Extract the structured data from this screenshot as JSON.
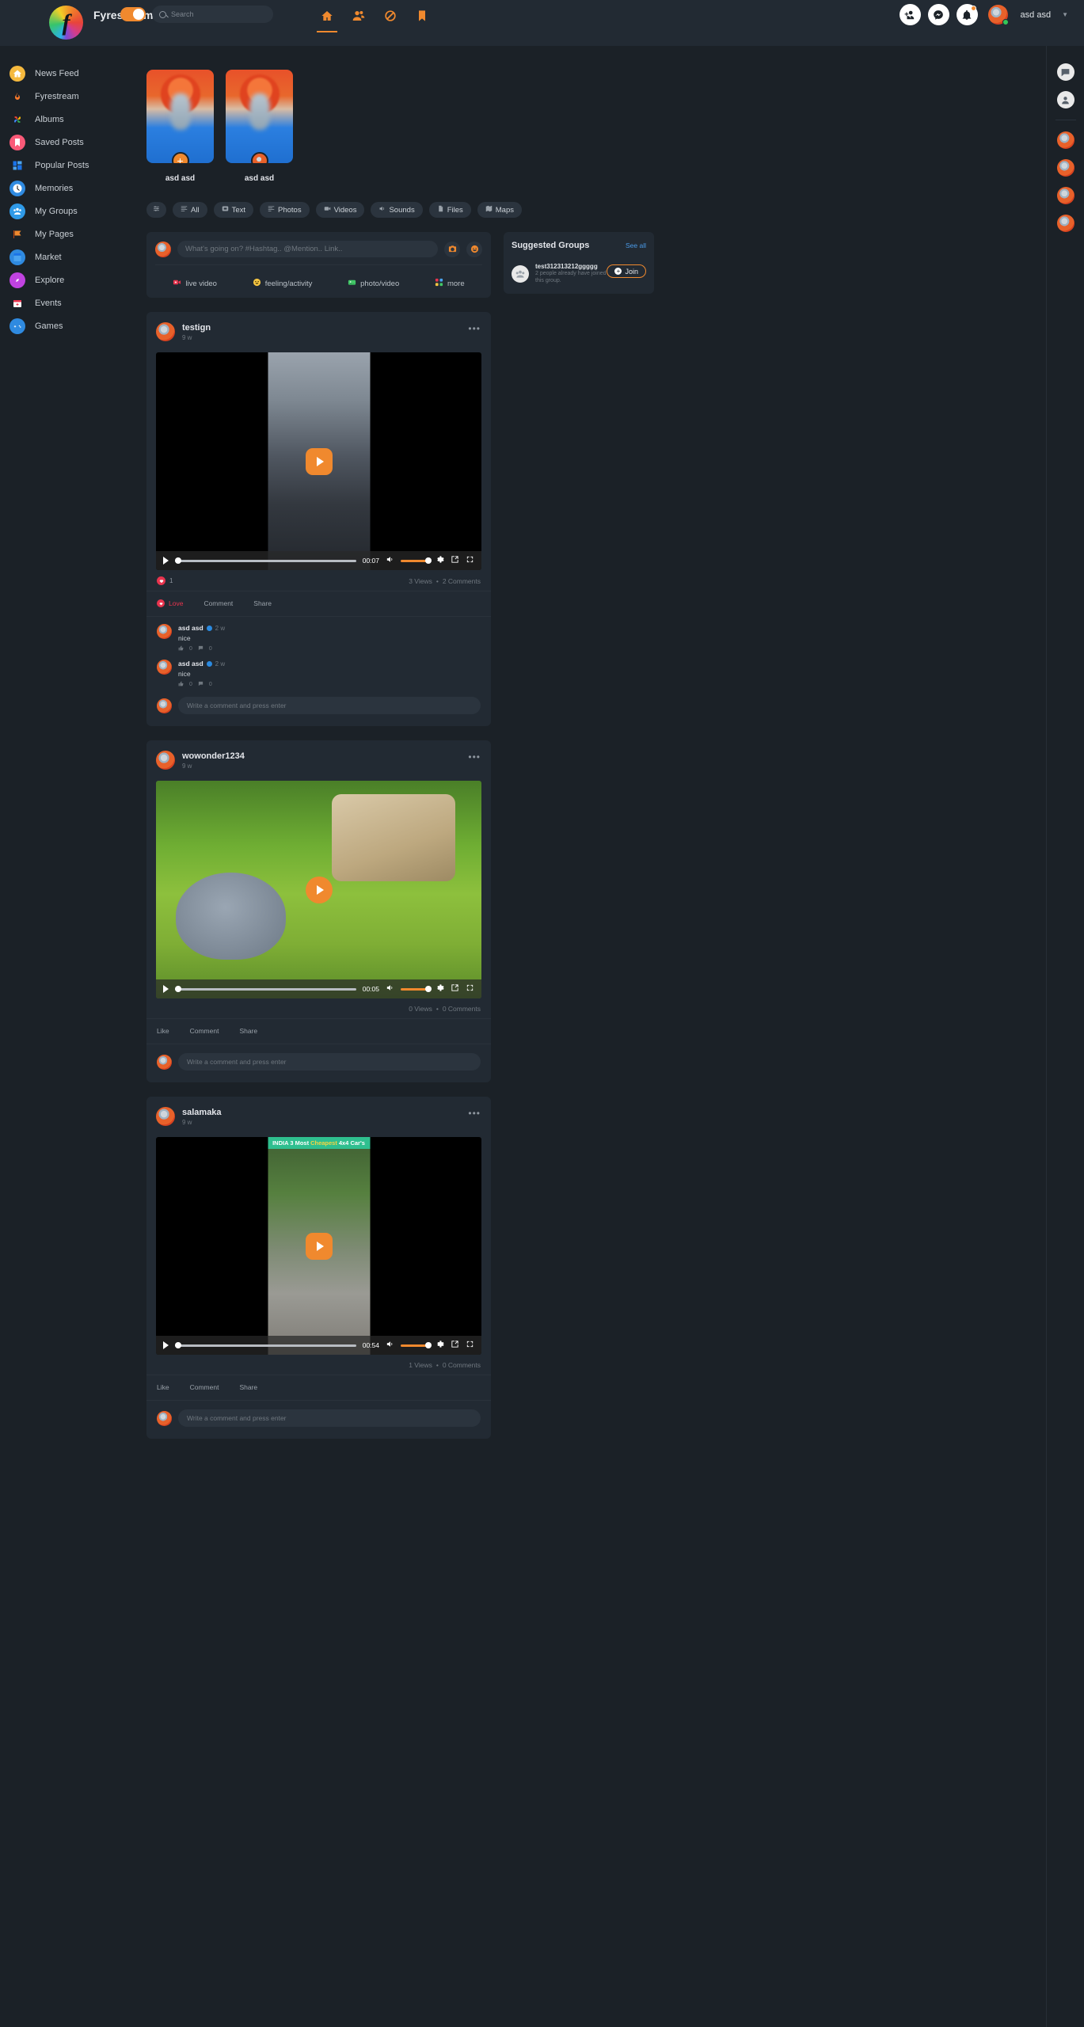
{
  "header": {
    "brand": "Fyrestream",
    "logo_letter": "f",
    "search_placeholder": "Search",
    "toggle_on": true,
    "nav": [
      {
        "name": "home-icon",
        "label": "Home",
        "active": true
      },
      {
        "name": "friends-icon",
        "label": "Friends",
        "active": false
      },
      {
        "name": "explore-icon",
        "label": "Explore",
        "active": false
      },
      {
        "name": "bookmark-icon",
        "label": "Saved",
        "active": false
      }
    ],
    "actions": [
      {
        "name": "add-friend-icon",
        "label": "Add Friend"
      },
      {
        "name": "messenger-icon",
        "label": "Messages"
      },
      {
        "name": "notifications-icon",
        "label": "Notifications",
        "has_dot": true
      }
    ],
    "user": {
      "name": "asd asd",
      "online": true
    }
  },
  "sidebar": {
    "items": [
      {
        "label": "News Feed",
        "icon": "house-icon",
        "color": "#f5b93e"
      },
      {
        "label": "Fyrestream",
        "icon": "flame-icon",
        "color": "#ff6a1f"
      },
      {
        "label": "Albums",
        "icon": "pinwheel-icon",
        "color": "#4285f4"
      },
      {
        "label": "Saved Posts",
        "icon": "bookmark-icon",
        "color": "#fa5a78"
      },
      {
        "label": "Popular Posts",
        "icon": "grid-icon",
        "color": "#2f8ae0"
      },
      {
        "label": "Memories",
        "icon": "clock-icon",
        "color": "#2f8ae0"
      },
      {
        "label": "My Groups",
        "icon": "people-icon",
        "color": "#2f9ae8"
      },
      {
        "label": "My Pages",
        "icon": "flag-icon",
        "color": "#f0892e"
      },
      {
        "label": "Market",
        "icon": "store-icon",
        "color": "#2f8ae0"
      },
      {
        "label": "Explore",
        "icon": "compass-icon",
        "color": "#c043e0"
      },
      {
        "label": "Events",
        "icon": "calendar-icon",
        "color": "#e8344e"
      },
      {
        "label": "Games",
        "icon": "gamepad-icon",
        "color": "#2f8ae0"
      }
    ]
  },
  "stories": [
    {
      "name": "asd asd",
      "badge": "add",
      "badge_label": "+"
    },
    {
      "name": "asd asd",
      "badge": "avatar",
      "badge_label": ""
    }
  ],
  "filters": [
    {
      "label": "",
      "icon": "sliders-icon",
      "icon_only": true
    },
    {
      "label": "All",
      "icon": "list-icon"
    },
    {
      "label": "Text",
      "icon": "text-icon"
    },
    {
      "label": "Photos",
      "icon": "photos-icon"
    },
    {
      "label": "Videos",
      "icon": "video-icon"
    },
    {
      "label": "Sounds",
      "icon": "sound-icon"
    },
    {
      "label": "Files",
      "icon": "file-icon"
    },
    {
      "label": "Maps",
      "icon": "map-icon"
    }
  ],
  "composer": {
    "placeholder": "What's going on? #Hashtag.. @Mention.. Link..",
    "camera_icon": "camera-icon",
    "emoji_icon": "emoji-icon",
    "actions": [
      {
        "label": "live video",
        "icon": "live-video-icon",
        "color": "#e8344e"
      },
      {
        "label": "feeling/activity",
        "icon": "smiley-icon",
        "color": "#f5c542"
      },
      {
        "label": "photo/video",
        "icon": "photo-video-icon",
        "color": "#42c767"
      },
      {
        "label": "more",
        "icon": "more-grid-icon",
        "color": "#e8344e"
      }
    ]
  },
  "suggested_groups": {
    "title": "Suggested Groups",
    "see_all": "See all",
    "items": [
      {
        "name": "test312313212ggggg",
        "subtitle": "2 people already have joined this group.",
        "join_label": "Join"
      }
    ]
  },
  "posts": [
    {
      "author": "testign",
      "time": "9 w",
      "media_kind": "video-portrait-cars",
      "video": {
        "time": "00:07",
        "playing": false,
        "volume_full": true
      },
      "reaction_icon": "love-heart-icon",
      "reaction_count": "1",
      "views": "3 Views",
      "comments_count": "2 Comments",
      "separator": "•",
      "actions": [
        {
          "label": "Love",
          "state": "active"
        },
        {
          "label": "Comment",
          "state": "idle"
        },
        {
          "label": "Share",
          "state": "idle"
        }
      ],
      "comments": [
        {
          "author": "asd asd",
          "verified": true,
          "time": "2 w",
          "text": "nice",
          "likes": "0",
          "replies": "0"
        },
        {
          "author": "asd asd",
          "verified": true,
          "time": "2 w",
          "text": "nice",
          "likes": "0",
          "replies": "0"
        }
      ],
      "comment_placeholder": "Write a comment and press enter"
    },
    {
      "author": "wowonder1234",
      "time": "9 w",
      "media_kind": "video-landscape-bunny",
      "video": {
        "time": "00:05",
        "playing": false,
        "volume_full": true
      },
      "views": "0 Views",
      "comments_count": "0 Comments",
      "separator": "•",
      "actions": [
        {
          "label": "Like",
          "state": "idle"
        },
        {
          "label": "Comment",
          "state": "idle"
        },
        {
          "label": "Share",
          "state": "idle"
        }
      ],
      "comments": [],
      "comment_placeholder": "Write a comment and press enter"
    },
    {
      "author": "salamaka",
      "time": "9 w",
      "media_kind": "video-portrait-jeep",
      "video_title_prefix": "INDIA 3 Most ",
      "video_title_highlight": "Cheapest",
      "video_title_suffix": " 4x4 Car's",
      "video": {
        "time": "00:54",
        "playing": false,
        "volume_full": true
      },
      "views": "1 Views",
      "comments_count": "0 Comments",
      "separator": "•",
      "actions": [
        {
          "label": "Like",
          "state": "idle"
        },
        {
          "label": "Comment",
          "state": "idle"
        },
        {
          "label": "Share",
          "state": "idle"
        }
      ],
      "comments": [],
      "comment_placeholder": "Write a comment and press enter"
    }
  ],
  "right_rail": {
    "buttons": [
      {
        "name": "chat-list-icon"
      },
      {
        "name": "contacts-icon"
      }
    ],
    "contacts": [
      {
        "name": "contact-avatar"
      },
      {
        "name": "contact-avatar"
      },
      {
        "name": "contact-avatar"
      },
      {
        "name": "contact-avatar"
      }
    ]
  },
  "colors": {
    "accent": "#f0892e",
    "bg": "#1b2127",
    "card": "#222a33",
    "input": "#2b343e",
    "link": "#4a9ae8",
    "love": "#e8344e"
  }
}
